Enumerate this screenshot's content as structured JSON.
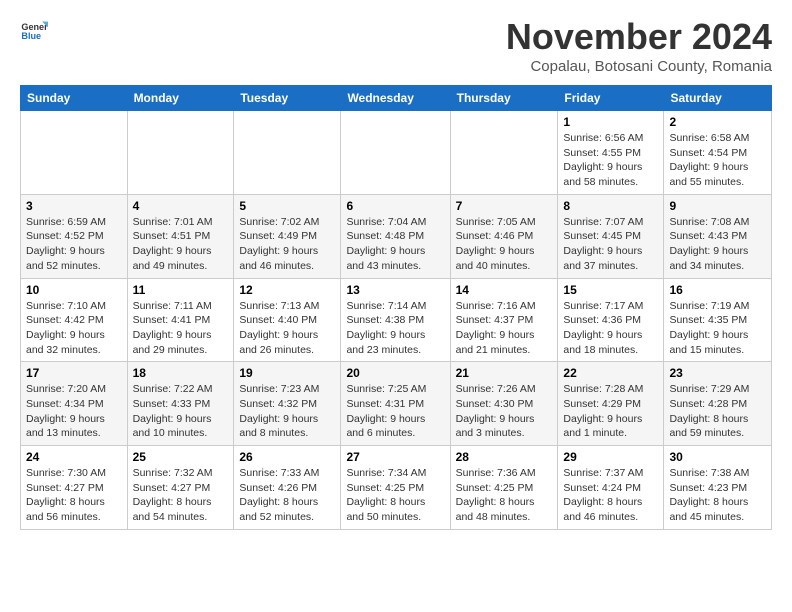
{
  "header": {
    "logo_general": "General",
    "logo_blue": "Blue",
    "title": "November 2024",
    "subtitle": "Copalau, Botosani County, Romania"
  },
  "days_of_week": [
    "Sunday",
    "Monday",
    "Tuesday",
    "Wednesday",
    "Thursday",
    "Friday",
    "Saturday"
  ],
  "weeks": [
    {
      "cells": [
        {
          "day": "",
          "info": ""
        },
        {
          "day": "",
          "info": ""
        },
        {
          "day": "",
          "info": ""
        },
        {
          "day": "",
          "info": ""
        },
        {
          "day": "",
          "info": ""
        },
        {
          "day": "1",
          "info": "Sunrise: 6:56 AM\nSunset: 4:55 PM\nDaylight: 9 hours and 58 minutes."
        },
        {
          "day": "2",
          "info": "Sunrise: 6:58 AM\nSunset: 4:54 PM\nDaylight: 9 hours and 55 minutes."
        }
      ]
    },
    {
      "cells": [
        {
          "day": "3",
          "info": "Sunrise: 6:59 AM\nSunset: 4:52 PM\nDaylight: 9 hours and 52 minutes."
        },
        {
          "day": "4",
          "info": "Sunrise: 7:01 AM\nSunset: 4:51 PM\nDaylight: 9 hours and 49 minutes."
        },
        {
          "day": "5",
          "info": "Sunrise: 7:02 AM\nSunset: 4:49 PM\nDaylight: 9 hours and 46 minutes."
        },
        {
          "day": "6",
          "info": "Sunrise: 7:04 AM\nSunset: 4:48 PM\nDaylight: 9 hours and 43 minutes."
        },
        {
          "day": "7",
          "info": "Sunrise: 7:05 AM\nSunset: 4:46 PM\nDaylight: 9 hours and 40 minutes."
        },
        {
          "day": "8",
          "info": "Sunrise: 7:07 AM\nSunset: 4:45 PM\nDaylight: 9 hours and 37 minutes."
        },
        {
          "day": "9",
          "info": "Sunrise: 7:08 AM\nSunset: 4:43 PM\nDaylight: 9 hours and 34 minutes."
        }
      ]
    },
    {
      "cells": [
        {
          "day": "10",
          "info": "Sunrise: 7:10 AM\nSunset: 4:42 PM\nDaylight: 9 hours and 32 minutes."
        },
        {
          "day": "11",
          "info": "Sunrise: 7:11 AM\nSunset: 4:41 PM\nDaylight: 9 hours and 29 minutes."
        },
        {
          "day": "12",
          "info": "Sunrise: 7:13 AM\nSunset: 4:40 PM\nDaylight: 9 hours and 26 minutes."
        },
        {
          "day": "13",
          "info": "Sunrise: 7:14 AM\nSunset: 4:38 PM\nDaylight: 9 hours and 23 minutes."
        },
        {
          "day": "14",
          "info": "Sunrise: 7:16 AM\nSunset: 4:37 PM\nDaylight: 9 hours and 21 minutes."
        },
        {
          "day": "15",
          "info": "Sunrise: 7:17 AM\nSunset: 4:36 PM\nDaylight: 9 hours and 18 minutes."
        },
        {
          "day": "16",
          "info": "Sunrise: 7:19 AM\nSunset: 4:35 PM\nDaylight: 9 hours and 15 minutes."
        }
      ]
    },
    {
      "cells": [
        {
          "day": "17",
          "info": "Sunrise: 7:20 AM\nSunset: 4:34 PM\nDaylight: 9 hours and 13 minutes."
        },
        {
          "day": "18",
          "info": "Sunrise: 7:22 AM\nSunset: 4:33 PM\nDaylight: 9 hours and 10 minutes."
        },
        {
          "day": "19",
          "info": "Sunrise: 7:23 AM\nSunset: 4:32 PM\nDaylight: 9 hours and 8 minutes."
        },
        {
          "day": "20",
          "info": "Sunrise: 7:25 AM\nSunset: 4:31 PM\nDaylight: 9 hours and 6 minutes."
        },
        {
          "day": "21",
          "info": "Sunrise: 7:26 AM\nSunset: 4:30 PM\nDaylight: 9 hours and 3 minutes."
        },
        {
          "day": "22",
          "info": "Sunrise: 7:28 AM\nSunset: 4:29 PM\nDaylight: 9 hours and 1 minute."
        },
        {
          "day": "23",
          "info": "Sunrise: 7:29 AM\nSunset: 4:28 PM\nDaylight: 8 hours and 59 minutes."
        }
      ]
    },
    {
      "cells": [
        {
          "day": "24",
          "info": "Sunrise: 7:30 AM\nSunset: 4:27 PM\nDaylight: 8 hours and 56 minutes."
        },
        {
          "day": "25",
          "info": "Sunrise: 7:32 AM\nSunset: 4:27 PM\nDaylight: 8 hours and 54 minutes."
        },
        {
          "day": "26",
          "info": "Sunrise: 7:33 AM\nSunset: 4:26 PM\nDaylight: 8 hours and 52 minutes."
        },
        {
          "day": "27",
          "info": "Sunrise: 7:34 AM\nSunset: 4:25 PM\nDaylight: 8 hours and 50 minutes."
        },
        {
          "day": "28",
          "info": "Sunrise: 7:36 AM\nSunset: 4:25 PM\nDaylight: 8 hours and 48 minutes."
        },
        {
          "day": "29",
          "info": "Sunrise: 7:37 AM\nSunset: 4:24 PM\nDaylight: 8 hours and 46 minutes."
        },
        {
          "day": "30",
          "info": "Sunrise: 7:38 AM\nSunset: 4:23 PM\nDaylight: 8 hours and 45 minutes."
        }
      ]
    }
  ]
}
